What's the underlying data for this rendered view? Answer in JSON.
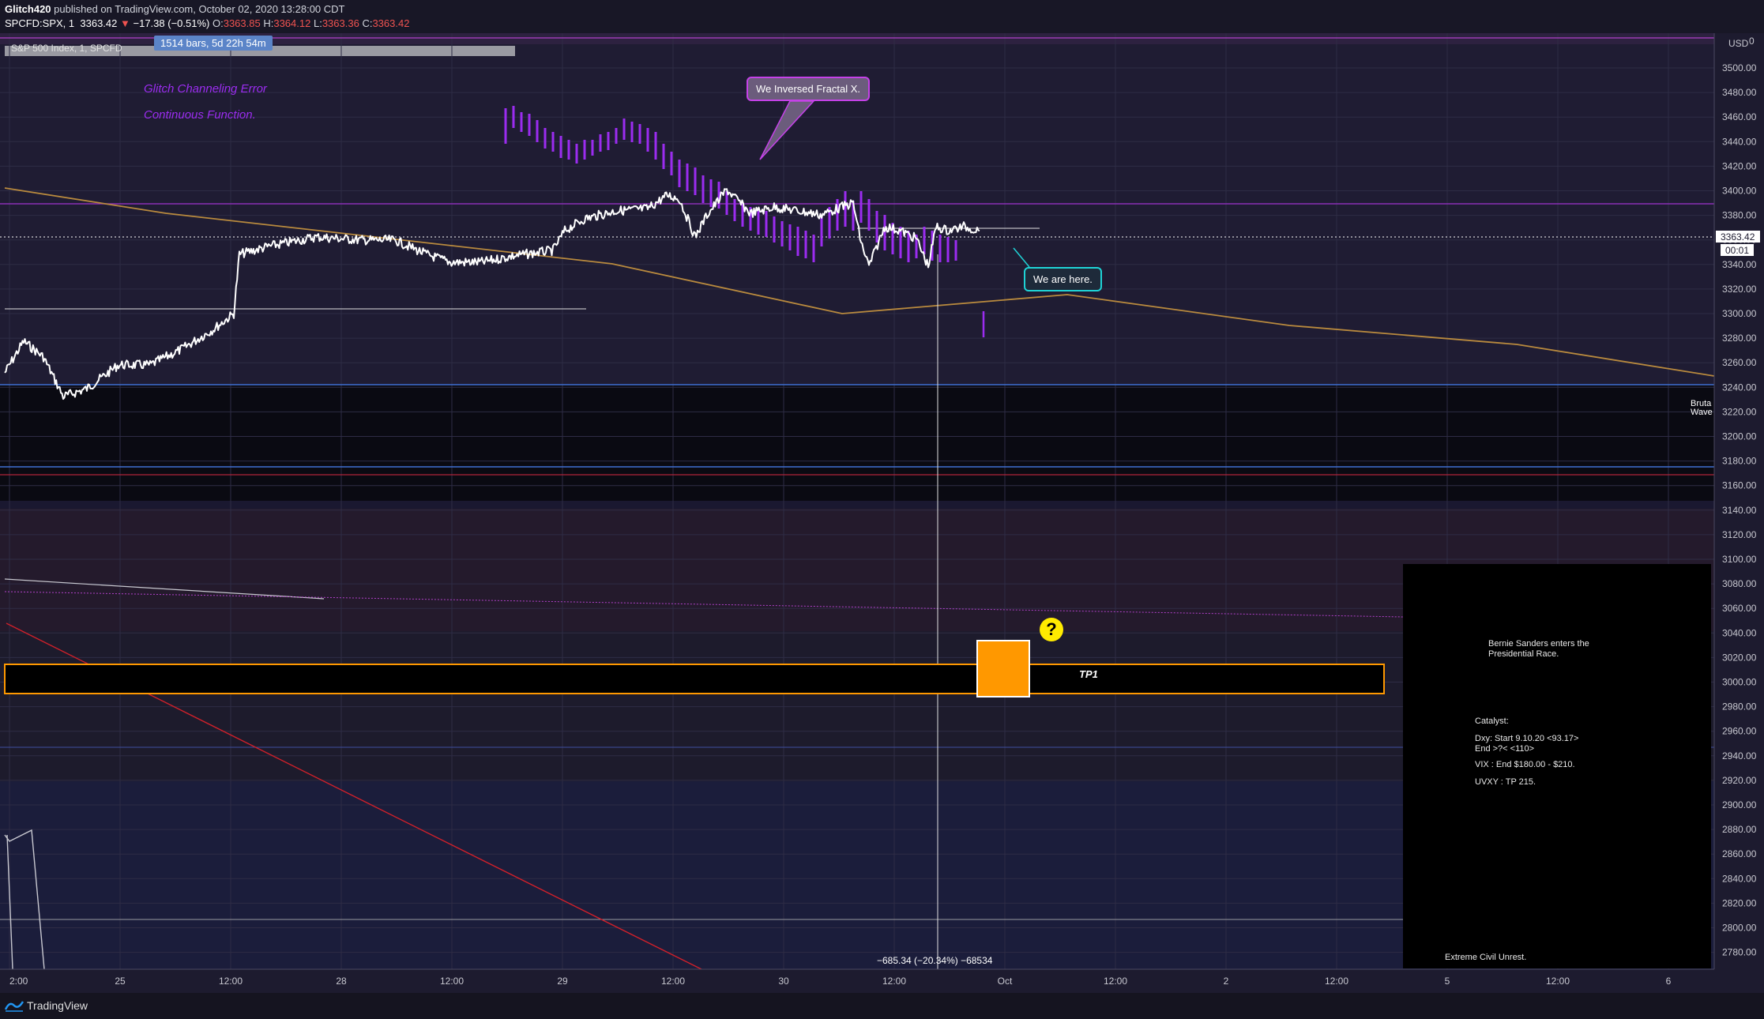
{
  "header": {
    "author": "Glitch420",
    "published_text": "published on TradingView.com, October 02, 2020 13:28:00 CDT",
    "symbol": "SPCFD:SPX, 1",
    "last": "3363.42",
    "change_arrow": "▼",
    "change": "−17.38 (−0.51%)",
    "o_label": "O:",
    "o_value": "3363.85",
    "h_label": "H:",
    "h_value": "3364.12",
    "l_label": "L:",
    "l_value": "3363.36",
    "c_label": "C:",
    "c_value": "3363.42"
  },
  "legend": {
    "bars_range": "1514 bars, 5d 22h 54m",
    "series_title": "S&P 500 Index, 1, SPCFD"
  },
  "notes": {
    "line1": "Glitch Channeling Error",
    "line2": "Continuous Function.",
    "callout_top": "We Inversed Fractal X.",
    "callout_here": "We are here.",
    "tp1": "TP1",
    "question": "?",
    "measure": "−685.34 (−20.34%) −68534",
    "bruta_1": "Bruta",
    "bruta_2": "Wave"
  },
  "panel": {
    "bernie": "Bernie Sanders enters the\nPresidential Race.",
    "catalyst": "Catalyst:",
    "dxy": "Dxy: Start 9.10.20 <93.17>\nEnd >?< <110>",
    "vix": "VIX : End $180.00 - $210.",
    "uvxy": "UVXY : TP 215.",
    "unrest": "Extreme Civil Unrest."
  },
  "price_axis": {
    "currency": "USD",
    "labels": [
      "3500.00",
      "3480.00",
      "3460.00",
      "3440.00",
      "3420.00",
      "3400.00",
      "3380.00",
      "3360.00",
      "3340.00",
      "3320.00",
      "3300.00",
      "3280.00",
      "3260.00",
      "3240.00",
      "3220.00",
      "3200.00",
      "3180.00",
      "3160.00",
      "3140.00",
      "3120.00",
      "3100.00",
      "3080.00",
      "3060.00",
      "3040.00",
      "3020.00",
      "3000.00",
      "2980.00",
      "2960.00",
      "2940.00",
      "2920.00",
      "2900.00",
      "2880.00",
      "2860.00",
      "2840.00",
      "2820.00",
      "2800.00",
      "2780.00"
    ],
    "current_price": "3363.42",
    "countdown": "00:01"
  },
  "time_axis": {
    "labels": [
      "2:00",
      "25",
      "12:00",
      "28",
      "12:00",
      "29",
      "12:00",
      "30",
      "12:00",
      "Oct",
      "12:00",
      "2",
      "12:00",
      "5",
      "12:00",
      "6"
    ]
  },
  "footer": {
    "brand": "TradingView"
  },
  "colors": {
    "background": "#1d1b2f",
    "price_line": "#ffffff",
    "purple": "#9b2cf0",
    "orange": "#ff9800",
    "gold_line": "#b98a3e",
    "blue_line": "#3f6fd1",
    "red_line": "#d0202a"
  }
}
